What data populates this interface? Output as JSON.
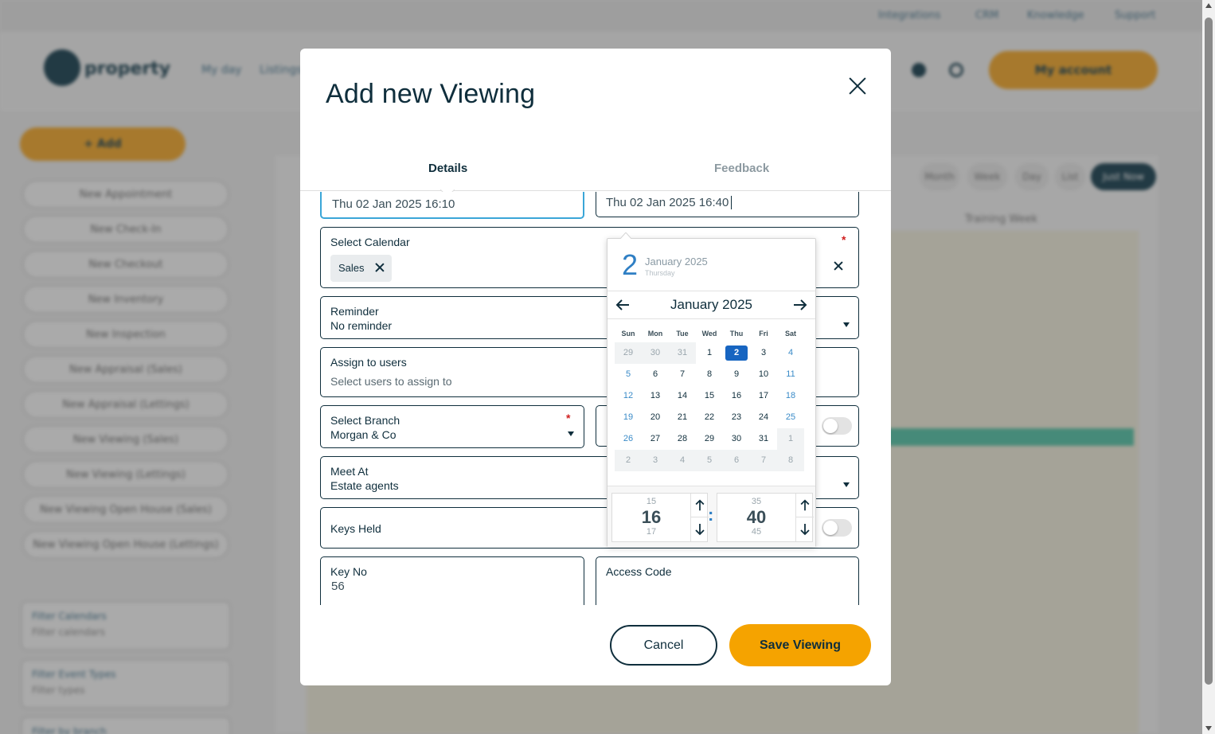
{
  "modal": {
    "title": "Add new Viewing",
    "tabs": [
      "Details",
      "Feedback"
    ],
    "start_datetime": "Thu 02 Jan 2025 16:10",
    "end_datetime": "Thu 02 Jan 2025 16:40",
    "calendar": {
      "label": "Select Calendar",
      "chip": "Sales",
      "required": "*"
    },
    "reminder": {
      "label": "Reminder",
      "value": "No reminder"
    },
    "assign": {
      "label": "Assign to users",
      "placeholder": "Select users to assign to"
    },
    "branch": {
      "label": "Select Branch",
      "value": "Morgan & Co",
      "required": "*"
    },
    "meet_at": {
      "label": "Meet At",
      "value": "Estate agents"
    },
    "keys_held": {
      "label": "Keys Held",
      "enabled": false
    },
    "key_no": {
      "label": "Key No",
      "value": "56"
    },
    "access_code": {
      "label": "Access Code",
      "value": ""
    },
    "buttons": {
      "cancel": "Cancel",
      "save": "Save Viewing"
    }
  },
  "datepicker": {
    "selected_day": "2",
    "selected_month_year": "January 2025",
    "selected_weekday": "Thursday",
    "month_label": "January 2025",
    "weekdays": [
      "Sun",
      "Mon",
      "Tue",
      "Wed",
      "Thu",
      "Fri",
      "Sat"
    ],
    "weeks": [
      [
        [
          "29",
          "other"
        ],
        [
          "30",
          "other"
        ],
        [
          "31",
          "other"
        ],
        [
          "1",
          ""
        ],
        [
          "2",
          "selected"
        ],
        [
          "3",
          ""
        ],
        [
          "4",
          "weekend"
        ]
      ],
      [
        [
          "5",
          "weekend"
        ],
        [
          "6",
          ""
        ],
        [
          "7",
          ""
        ],
        [
          "8",
          ""
        ],
        [
          "9",
          ""
        ],
        [
          "10",
          ""
        ],
        [
          "11",
          "weekend"
        ]
      ],
      [
        [
          "12",
          "weekend"
        ],
        [
          "13",
          ""
        ],
        [
          "14",
          ""
        ],
        [
          "15",
          ""
        ],
        [
          "16",
          ""
        ],
        [
          "17",
          ""
        ],
        [
          "18",
          "weekend"
        ]
      ],
      [
        [
          "19",
          "weekend"
        ],
        [
          "20",
          ""
        ],
        [
          "21",
          ""
        ],
        [
          "22",
          ""
        ],
        [
          "23",
          ""
        ],
        [
          "24",
          ""
        ],
        [
          "25",
          "weekend"
        ]
      ],
      [
        [
          "26",
          "weekend"
        ],
        [
          "27",
          ""
        ],
        [
          "28",
          ""
        ],
        [
          "29",
          ""
        ],
        [
          "30",
          ""
        ],
        [
          "31",
          ""
        ],
        [
          "1",
          "other"
        ]
      ],
      [
        [
          "2",
          "other"
        ],
        [
          "3",
          "other"
        ],
        [
          "4",
          "other"
        ],
        [
          "5",
          "other"
        ],
        [
          "6",
          "other"
        ],
        [
          "7",
          "other"
        ],
        [
          "8",
          "other"
        ]
      ]
    ],
    "hours": {
      "prev": "15",
      "current": "16",
      "next": "17"
    },
    "minutes": {
      "prev": "35",
      "current": "40",
      "next": "45"
    },
    "separator": ":"
  },
  "background": {
    "top_links": [
      "Integrations",
      "CRM",
      "Knowledge",
      "Support"
    ],
    "logo_text": "property",
    "nav": [
      "My day",
      "Listings"
    ],
    "my_account": "My account",
    "add_button": "+ Add",
    "sidebar_items": [
      "New Appointment",
      "New Check-In",
      "New Checkout",
      "New Inventory",
      "New Inspection",
      "New Appraisal (Sales)",
      "New Appraisal (Lettings)",
      "New Viewing (Sales)",
      "New Viewing (Lettings)",
      "New Viewing Open House (Sales)",
      "New Viewing Open House (Lettings)"
    ],
    "filters": [
      {
        "label": "Filter Calendars",
        "value": "Filter calendars"
      },
      {
        "label": "Filter Event Types",
        "value": "Filter types"
      },
      {
        "label": "Filter by branch",
        "value": ""
      }
    ],
    "view_buttons": [
      "Month",
      "Week",
      "Day",
      "List",
      "Just Now"
    ],
    "grid_header": "Training Week",
    "accent_colors": {
      "orange": "#f5a300",
      "navy": "#0f2e3c",
      "blue": "#1765c1",
      "teal": "#4fc3a5"
    }
  }
}
